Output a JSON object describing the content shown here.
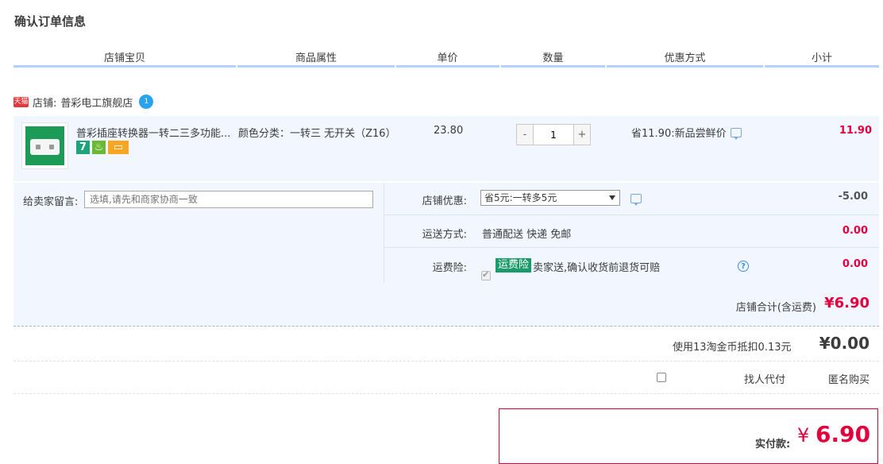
{
  "page_title": "确认订单信息",
  "columns": [
    "店铺宝贝",
    "商品属性",
    "单价",
    "数量",
    "优惠方式",
    "小计"
  ],
  "shop": {
    "badge": "天猫",
    "label": "店铺:",
    "name": "普彩电工旗舰店"
  },
  "item": {
    "title": "普彩插座转换器一转二三多功能...",
    "icon_7": "7",
    "icon_g": "♨",
    "icon_c": "▭",
    "attributes": "颜色分类：一转三 无开关（Z16）",
    "unit_price": "23.80",
    "qty_minus": "-",
    "quantity": "1",
    "qty_plus": "+",
    "discount": "省11.90:新品尝鲜价",
    "subtotal": "11.90"
  },
  "message": {
    "label": "给卖家留言:",
    "placeholder": "选填,请先和商家协商一致"
  },
  "shop_discount": {
    "label": "店铺优惠:",
    "selected": "省5元:一转多5元",
    "amount": "-5.00"
  },
  "shipping": {
    "label": "运送方式:",
    "value": "普通配送 快递 免邮",
    "amount": "0.00"
  },
  "insurance": {
    "label": "运费险:",
    "badge": "运费险",
    "desc": "卖家送,确认收货前退货可赔",
    "help": "?",
    "amount": "0.00"
  },
  "shop_total": {
    "label": "店铺合计(含运费)",
    "value": "¥6.90"
  },
  "coins": {
    "label": "使用13淘金币抵扣0.13元",
    "value": "¥0.00"
  },
  "proxy_pay": {
    "label": "找人代付"
  },
  "anonymous": {
    "label": "匿名购买"
  },
  "payment": {
    "label": "实付款:",
    "currency": "¥",
    "value": "6.90"
  },
  "colors": {
    "accent_red": "#e4003d",
    "panel_blue": "#f2f7ff",
    "header_line": "#b2d1ff"
  }
}
